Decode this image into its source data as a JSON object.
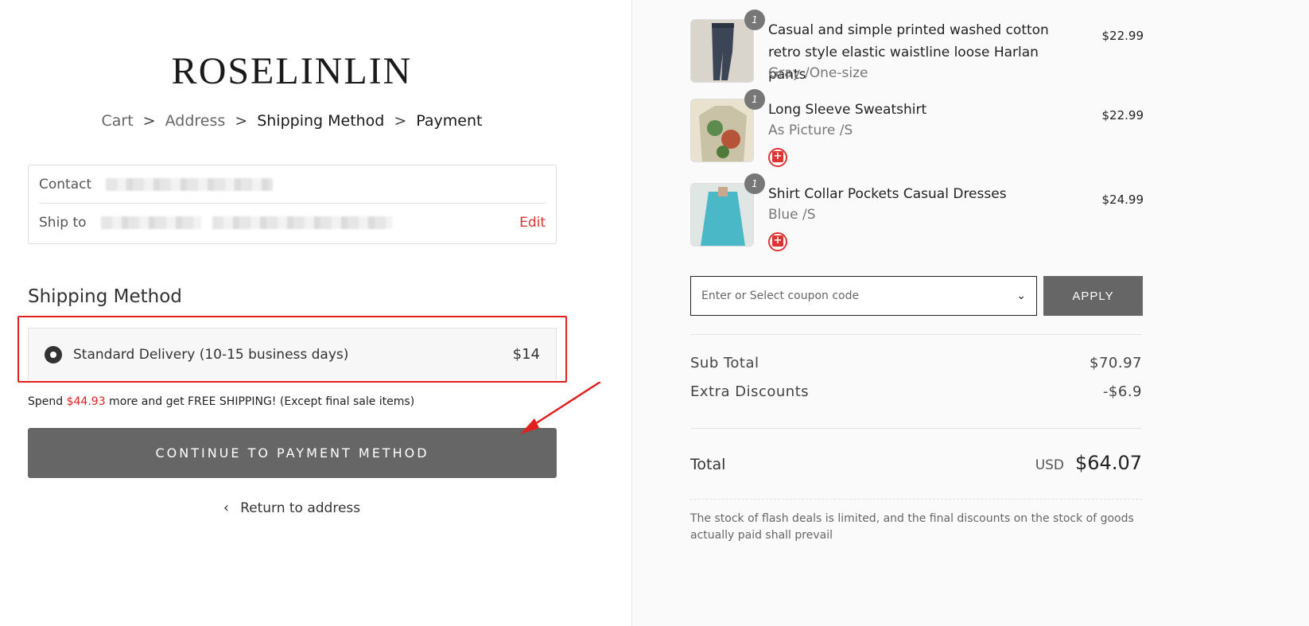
{
  "brand": {
    "logo_text": "ROSELINLIN"
  },
  "breadcrumb": {
    "items": [
      "Cart",
      "Address",
      "Shipping Method",
      "Payment"
    ],
    "separator": ">"
  },
  "contact": {
    "contact_label": "Contact",
    "ship_to_label": "Ship to",
    "edit_label": "Edit"
  },
  "shipping": {
    "title": "Shipping Method",
    "option_label": "Standard Delivery (10-15 business days)",
    "option_price": "$14",
    "promo_before": "Spend ",
    "promo_amount": "$44.93",
    "promo_after": " more and get FREE SHIPPING! (Except final sale items)"
  },
  "actions": {
    "continue_label": "CONTINUE TO PAYMENT METHOD",
    "return_label": "Return to address"
  },
  "order": {
    "items": [
      {
        "qty": "1",
        "name": "Casual and simple printed washed cotton retro style elastic waistline loose Harlan pants",
        "variant": "Gray /One-size",
        "price": "$22.99"
      },
      {
        "qty": "1",
        "name": "Long Sleeve Sweatshirt",
        "variant": "As Picture /S",
        "price": "$22.99"
      },
      {
        "qty": "1",
        "name": "Shirt Collar Pockets Casual Dresses",
        "variant": "Blue /S",
        "price": "$24.99"
      }
    ],
    "coupon_placeholder": "Enter or Select coupon code",
    "apply_label": "APPLY",
    "subtotal_label": "Sub Total",
    "subtotal_value": "$70.97",
    "discount_label": "Extra Discounts",
    "discount_value": "-$6.9",
    "total_label": "Total",
    "currency": "USD",
    "total_value": "$64.07",
    "note": "The stock of flash deals is limited, and the final discounts on the stock of goods actually paid shall prevail"
  },
  "colors": {
    "accent_red": "#e02020",
    "button_gray": "#666666"
  },
  "icons": [
    "radio-selected-icon",
    "chevron-left-icon",
    "chevron-down-icon",
    "gift-icon",
    "annotation-arrow"
  ]
}
